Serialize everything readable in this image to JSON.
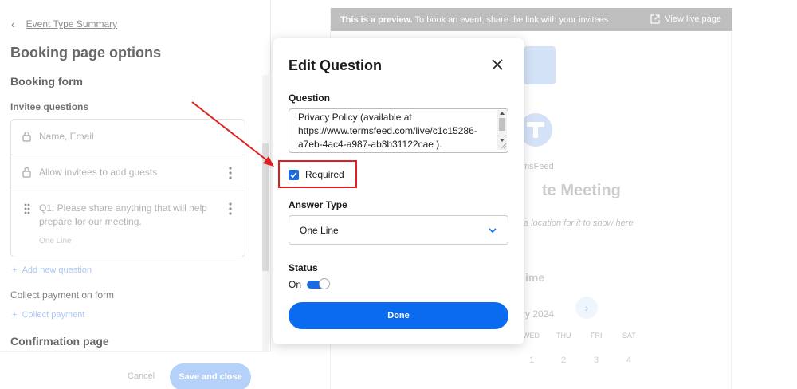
{
  "left_panel": {
    "back_label": "Event Type Summary",
    "title": "Booking page options",
    "booking_form_title": "Booking form",
    "invitee_questions_title": "Invitee questions",
    "questions": [
      {
        "text": "Name, Email"
      },
      {
        "text": "Allow invitees to add guests"
      },
      {
        "text": "Q1: Please share anything that will help prepare for our meeting.",
        "answer_type": "One Line"
      }
    ],
    "add_question_label": "Add new question",
    "collect_payment_title": "Collect payment on form",
    "collect_payment_label": "Collect payment",
    "confirmation_title": "Confirmation page",
    "cancel_label": "Cancel",
    "save_label": "Save and close"
  },
  "preview": {
    "banner_bold": "This is a preview.",
    "banner_text": " To book an event, share the link with your invitees.",
    "view_live_label": "View live page",
    "company": "msFeed",
    "meeting_title": "te Meeting",
    "location_hint": "a location for it to show here",
    "time_title": "ime",
    "month": "y 2024",
    "weekdays": [
      "WED",
      "THU",
      "FRI",
      "SAT"
    ],
    "days": [
      "1",
      "2",
      "3",
      "4"
    ]
  },
  "modal": {
    "title": "Edit Question",
    "question_label": "Question",
    "question_text": "Privacy Policy (available at https://www.termsfeed.com/live/c1c15286-a7eb-4ac4-a987-ab3b31122cae ).",
    "required_label": "Required",
    "required_checked": true,
    "answer_type_label": "Answer Type",
    "answer_type_value": "One Line",
    "status_label": "Status",
    "status_value": "On",
    "done_label": "Done"
  },
  "colors": {
    "primary": "#0b6bf0",
    "highlight": "#e02020",
    "preview_banner": "#a8a8a8"
  }
}
